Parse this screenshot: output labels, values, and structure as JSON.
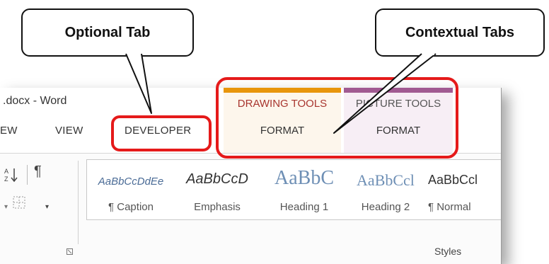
{
  "callouts": {
    "optional": "Optional Tab",
    "contextual": "Contextual Tabs"
  },
  "window": {
    "title": ".docx - Word"
  },
  "tabs": {
    "view_partial": "EW",
    "view": "VIEW",
    "developer": "DEVELOPER"
  },
  "contextual": {
    "drawing_tools": "DRAWING TOOLS",
    "picture_tools": "PICTURE TOOLS",
    "drawing_format": "FORMAT",
    "picture_format": "FORMAT",
    "drawing_color": "#e8960c",
    "picture_color": "#a15a92"
  },
  "styles": {
    "items": [
      {
        "sample": "AaBbCcDdEe",
        "name": "¶ Caption"
      },
      {
        "sample": "AaBbCcD",
        "name": "Emphasis"
      },
      {
        "sample": "AaBbC",
        "name": "Heading 1"
      },
      {
        "sample": "AaBbCcl",
        "name": "Heading 2"
      },
      {
        "sample": "AaBbCcl",
        "name": "¶ Normal"
      }
    ],
    "group_label": "Styles"
  },
  "icons": {
    "sort": "sort-az-icon",
    "pilcrow": "¶",
    "borders": "borders-icon",
    "launcher": "dialog-launcher-icon",
    "dropdown": "▾"
  },
  "highlight_color": "#e51a1a"
}
